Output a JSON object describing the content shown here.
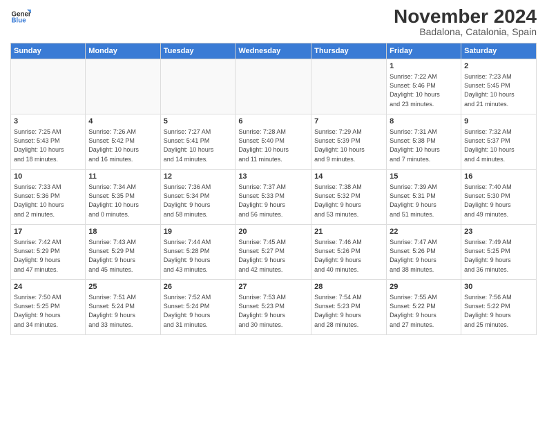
{
  "logo": {
    "line1": "General",
    "line2": "Blue"
  },
  "title": "November 2024",
  "subtitle": "Badalona, Catalonia, Spain",
  "headers": [
    "Sunday",
    "Monday",
    "Tuesday",
    "Wednesday",
    "Thursday",
    "Friday",
    "Saturday"
  ],
  "weeks": [
    [
      {
        "day": "",
        "info": ""
      },
      {
        "day": "",
        "info": ""
      },
      {
        "day": "",
        "info": ""
      },
      {
        "day": "",
        "info": ""
      },
      {
        "day": "",
        "info": ""
      },
      {
        "day": "1",
        "info": "Sunrise: 7:22 AM\nSunset: 5:46 PM\nDaylight: 10 hours\nand 23 minutes."
      },
      {
        "day": "2",
        "info": "Sunrise: 7:23 AM\nSunset: 5:45 PM\nDaylight: 10 hours\nand 21 minutes."
      }
    ],
    [
      {
        "day": "3",
        "info": "Sunrise: 7:25 AM\nSunset: 5:43 PM\nDaylight: 10 hours\nand 18 minutes."
      },
      {
        "day": "4",
        "info": "Sunrise: 7:26 AM\nSunset: 5:42 PM\nDaylight: 10 hours\nand 16 minutes."
      },
      {
        "day": "5",
        "info": "Sunrise: 7:27 AM\nSunset: 5:41 PM\nDaylight: 10 hours\nand 14 minutes."
      },
      {
        "day": "6",
        "info": "Sunrise: 7:28 AM\nSunset: 5:40 PM\nDaylight: 10 hours\nand 11 minutes."
      },
      {
        "day": "7",
        "info": "Sunrise: 7:29 AM\nSunset: 5:39 PM\nDaylight: 10 hours\nand 9 minutes."
      },
      {
        "day": "8",
        "info": "Sunrise: 7:31 AM\nSunset: 5:38 PM\nDaylight: 10 hours\nand 7 minutes."
      },
      {
        "day": "9",
        "info": "Sunrise: 7:32 AM\nSunset: 5:37 PM\nDaylight: 10 hours\nand 4 minutes."
      }
    ],
    [
      {
        "day": "10",
        "info": "Sunrise: 7:33 AM\nSunset: 5:36 PM\nDaylight: 10 hours\nand 2 minutes."
      },
      {
        "day": "11",
        "info": "Sunrise: 7:34 AM\nSunset: 5:35 PM\nDaylight: 10 hours\nand 0 minutes."
      },
      {
        "day": "12",
        "info": "Sunrise: 7:36 AM\nSunset: 5:34 PM\nDaylight: 9 hours\nand 58 minutes."
      },
      {
        "day": "13",
        "info": "Sunrise: 7:37 AM\nSunset: 5:33 PM\nDaylight: 9 hours\nand 56 minutes."
      },
      {
        "day": "14",
        "info": "Sunrise: 7:38 AM\nSunset: 5:32 PM\nDaylight: 9 hours\nand 53 minutes."
      },
      {
        "day": "15",
        "info": "Sunrise: 7:39 AM\nSunset: 5:31 PM\nDaylight: 9 hours\nand 51 minutes."
      },
      {
        "day": "16",
        "info": "Sunrise: 7:40 AM\nSunset: 5:30 PM\nDaylight: 9 hours\nand 49 minutes."
      }
    ],
    [
      {
        "day": "17",
        "info": "Sunrise: 7:42 AM\nSunset: 5:29 PM\nDaylight: 9 hours\nand 47 minutes."
      },
      {
        "day": "18",
        "info": "Sunrise: 7:43 AM\nSunset: 5:29 PM\nDaylight: 9 hours\nand 45 minutes."
      },
      {
        "day": "19",
        "info": "Sunrise: 7:44 AM\nSunset: 5:28 PM\nDaylight: 9 hours\nand 43 minutes."
      },
      {
        "day": "20",
        "info": "Sunrise: 7:45 AM\nSunset: 5:27 PM\nDaylight: 9 hours\nand 42 minutes."
      },
      {
        "day": "21",
        "info": "Sunrise: 7:46 AM\nSunset: 5:26 PM\nDaylight: 9 hours\nand 40 minutes."
      },
      {
        "day": "22",
        "info": "Sunrise: 7:47 AM\nSunset: 5:26 PM\nDaylight: 9 hours\nand 38 minutes."
      },
      {
        "day": "23",
        "info": "Sunrise: 7:49 AM\nSunset: 5:25 PM\nDaylight: 9 hours\nand 36 minutes."
      }
    ],
    [
      {
        "day": "24",
        "info": "Sunrise: 7:50 AM\nSunset: 5:25 PM\nDaylight: 9 hours\nand 34 minutes."
      },
      {
        "day": "25",
        "info": "Sunrise: 7:51 AM\nSunset: 5:24 PM\nDaylight: 9 hours\nand 33 minutes."
      },
      {
        "day": "26",
        "info": "Sunrise: 7:52 AM\nSunset: 5:24 PM\nDaylight: 9 hours\nand 31 minutes."
      },
      {
        "day": "27",
        "info": "Sunrise: 7:53 AM\nSunset: 5:23 PM\nDaylight: 9 hours\nand 30 minutes."
      },
      {
        "day": "28",
        "info": "Sunrise: 7:54 AM\nSunset: 5:23 PM\nDaylight: 9 hours\nand 28 minutes."
      },
      {
        "day": "29",
        "info": "Sunrise: 7:55 AM\nSunset: 5:22 PM\nDaylight: 9 hours\nand 27 minutes."
      },
      {
        "day": "30",
        "info": "Sunrise: 7:56 AM\nSunset: 5:22 PM\nDaylight: 9 hours\nand 25 minutes."
      }
    ]
  ]
}
